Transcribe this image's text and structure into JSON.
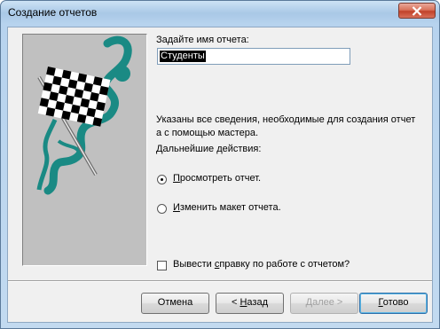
{
  "window": {
    "title": "Создание отчетов"
  },
  "form": {
    "name_label": "Задайте имя отчета:",
    "report_name": "Студенты",
    "info_line1": "Указаны все сведения, необходимые для создания отчет",
    "info_line2": "а с помощью мастера.",
    "next_actions_label": "Дальнейшие действия:",
    "options": [
      {
        "label_u": "П",
        "label_rest": "росмотреть отчет.",
        "selected": true
      },
      {
        "label_u": "И",
        "label_rest": "зменить макет отчета.",
        "selected": false
      }
    ],
    "help_checkbox": {
      "label_before": "Вывести ",
      "label_u": "с",
      "label_rest": "правку по работе с отчетом?",
      "checked": false
    }
  },
  "buttons": {
    "cancel": "Отмена",
    "back_prefix": "< ",
    "back_u": "Н",
    "back_rest": "азад",
    "next_u": "Д",
    "next_rest": "алее >",
    "finish_u": "Г",
    "finish_rest": "отово"
  },
  "colors": {
    "accent": "#1a8a84",
    "flag_dark": "#000000"
  }
}
